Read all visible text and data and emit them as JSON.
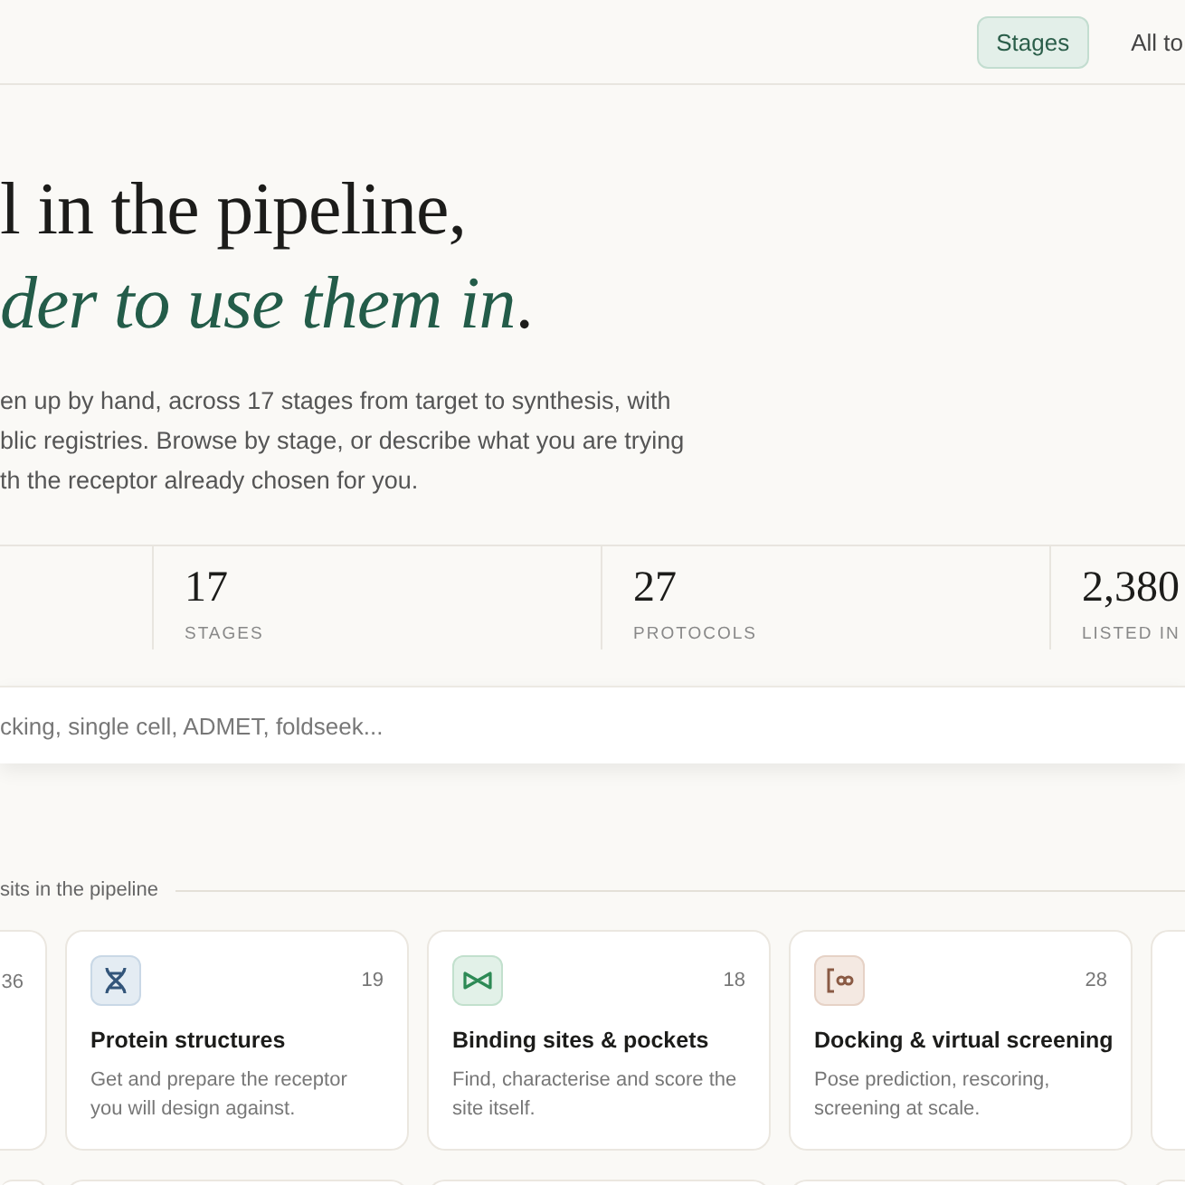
{
  "nav": [
    {
      "label": "Stages",
      "selected": true
    },
    {
      "label": "All to",
      "selected": false
    }
  ],
  "hero": {
    "heading_line_1": "l in the pipeline,",
    "heading_line_2": "*der to use them in*.",
    "intro": "en up by hand, across 17 stages from target to synthesis, with\nblic registries. Browse by stage, or describe what you are trying\nth the receptor already chosen for you."
  },
  "stats": [
    {
      "value": "17",
      "label": "STAGES"
    },
    {
      "value": "27",
      "label": "PROTOCOLS"
    },
    {
      "value": "2,380",
      "label": "LISTED IN"
    }
  ],
  "search": {
    "placeholder": "cking, single cell, ADMET, foldseek..."
  },
  "section_label": "sits in the pipeline",
  "cards": [
    {
      "count": "36"
    },
    {
      "kind": "helix",
      "count": "19",
      "title": "Protein structures",
      "description": "Get and prepare the receptor you will design against."
    },
    {
      "kind": "bowtie",
      "count": "18",
      "title": "Binding sites & pockets",
      "description": "Find, characterise and score the site itself."
    },
    {
      "kind": "dock",
      "count": "28",
      "title": "Docking & virtual screening",
      "description": "Pose prediction, rescoring, screening at scale."
    }
  ]
}
